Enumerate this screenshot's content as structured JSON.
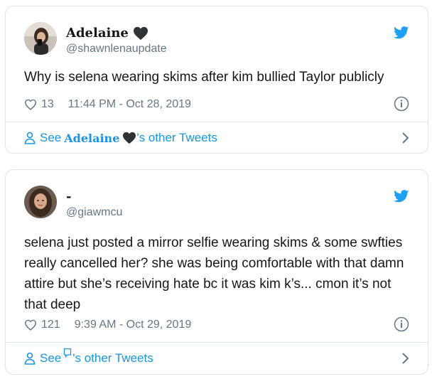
{
  "tweets": [
    {
      "display_name": "Adelaine",
      "name_emoji": "black-heart-icon",
      "handle": "@shawnlenaupdate",
      "text": "Why is selena wearing skims after kim bullied Taylor publicly",
      "likes": "13",
      "timestamp": "11:44 PM - Oct 28, 2019",
      "footer_prefix": "See",
      "footer_name": "Adelaine",
      "footer_suffix": "'s other Tweets"
    },
    {
      "display_name": "-",
      "handle": "@giawmcu",
      "text": "selena just posted a mirror selfie wearing skims & some swfties really cancelled her? she was being comfortable with that damn attire but she’s receiving hate bc it was kim k’s... cmon it’s not that deep",
      "likes": "121",
      "timestamp": "9:39 AM - Oct 29, 2019",
      "footer_prefix": "See",
      "footer_suffix": "'s other Tweets"
    }
  ],
  "colors": {
    "twitter_blue": "#1da1f2",
    "link_blue": "#1b95e0",
    "meta_gray": "#657786",
    "text": "#14171a",
    "border": "#dfe4e8"
  }
}
